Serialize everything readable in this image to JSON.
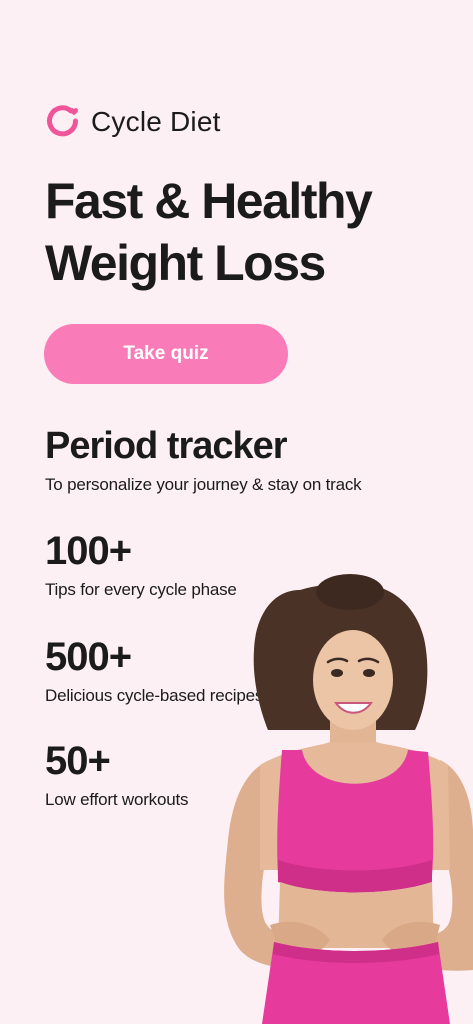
{
  "brand": {
    "name": "Cycle Diet",
    "icon": "cycle-ring-icon",
    "accent_color": "#f97cb8",
    "logo_color": "#f0559a"
  },
  "hero": {
    "headline_line1": "Fast & Healthy",
    "headline_line2": "Weight Loss"
  },
  "cta": {
    "label": "Take quiz"
  },
  "features": [
    {
      "title": "Period tracker",
      "description": "To personalize your journey & stay on track"
    },
    {
      "title": "100+",
      "description": "Tips for every cycle phase"
    },
    {
      "title": "500+",
      "description": "Delicious cycle-based recipes"
    },
    {
      "title": "50+",
      "description": "Low effort workouts"
    }
  ],
  "colors": {
    "background": "#fdf0f5",
    "text": "#1b1b1b",
    "outfit": "#e63a9c"
  }
}
